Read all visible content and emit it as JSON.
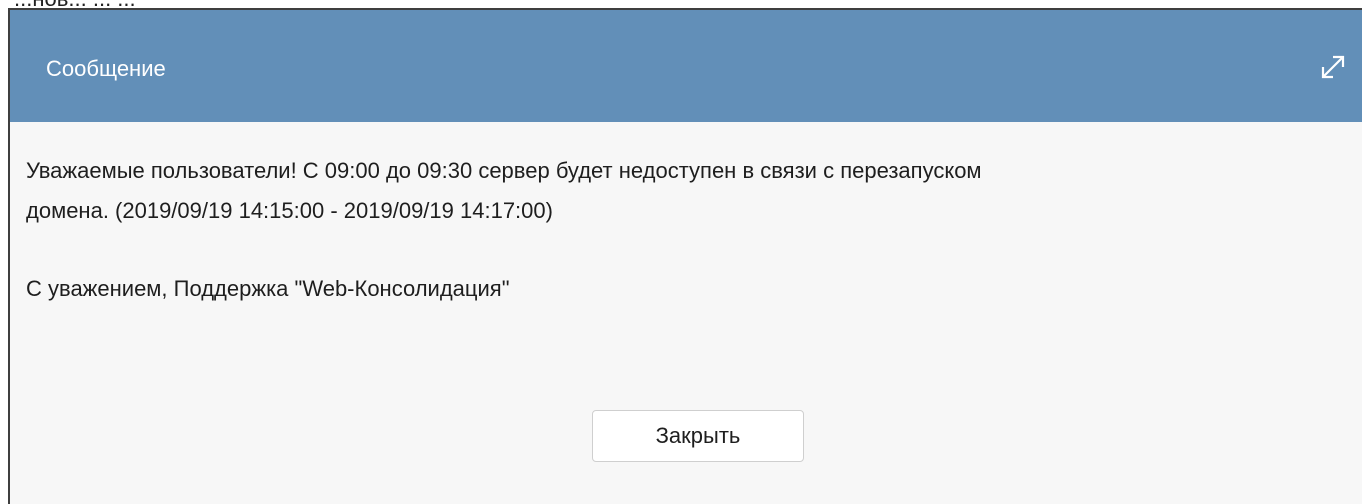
{
  "background": {
    "partial_text": "...нов... ... ..."
  },
  "dialog": {
    "title": "Сообщение",
    "expand_icon": "expand-arrows-icon",
    "message_line1": "Уважаемые пользователи! С 09:00 до 09:30 сервер будет недоступен в связи с перезапуском",
    "message_line2": "домена. (2019/09/19 14:15:00 - 2019/09/19 14:17:00)",
    "signature": "С уважением, Поддержка \"Web-Консолидация\"",
    "close_label": "Закрыть"
  },
  "colors": {
    "header_bg": "#628fb8",
    "body_bg": "#f7f7f7",
    "header_text": "#ffffff",
    "border": "#3f3f3f"
  }
}
